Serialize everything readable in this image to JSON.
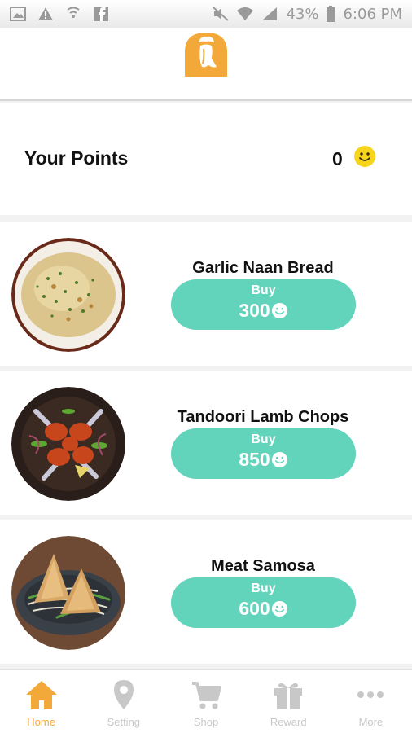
{
  "status_bar": {
    "battery": "43%",
    "time": "6:06 PM"
  },
  "header": {
    "logo_icon": "chef-logo-icon"
  },
  "points": {
    "label": "Your Points",
    "value": "0",
    "icon": "smiley-icon"
  },
  "items": [
    {
      "name": "Garlic Naan Bread",
      "buy_label": "Buy",
      "price": "300"
    },
    {
      "name": "Tandoori Lamb Chops",
      "buy_label": "Buy",
      "price": "850"
    },
    {
      "name": "Meat Samosa",
      "buy_label": "Buy",
      "price": "600"
    }
  ],
  "tabs": [
    {
      "label": "Home",
      "icon": "home-icon",
      "active": true
    },
    {
      "label": "Setting",
      "icon": "location-pin-icon",
      "active": false
    },
    {
      "label": "Shop",
      "icon": "cart-icon",
      "active": false
    },
    {
      "label": "Reward",
      "icon": "gift-icon",
      "active": false
    },
    {
      "label": "More",
      "icon": "more-dots-icon",
      "active": false
    }
  ],
  "colors": {
    "accent": "#f3a93a",
    "button": "#62d4bb",
    "smiley": "#f7d51c",
    "tab_inactive": "#c8c8c8"
  }
}
